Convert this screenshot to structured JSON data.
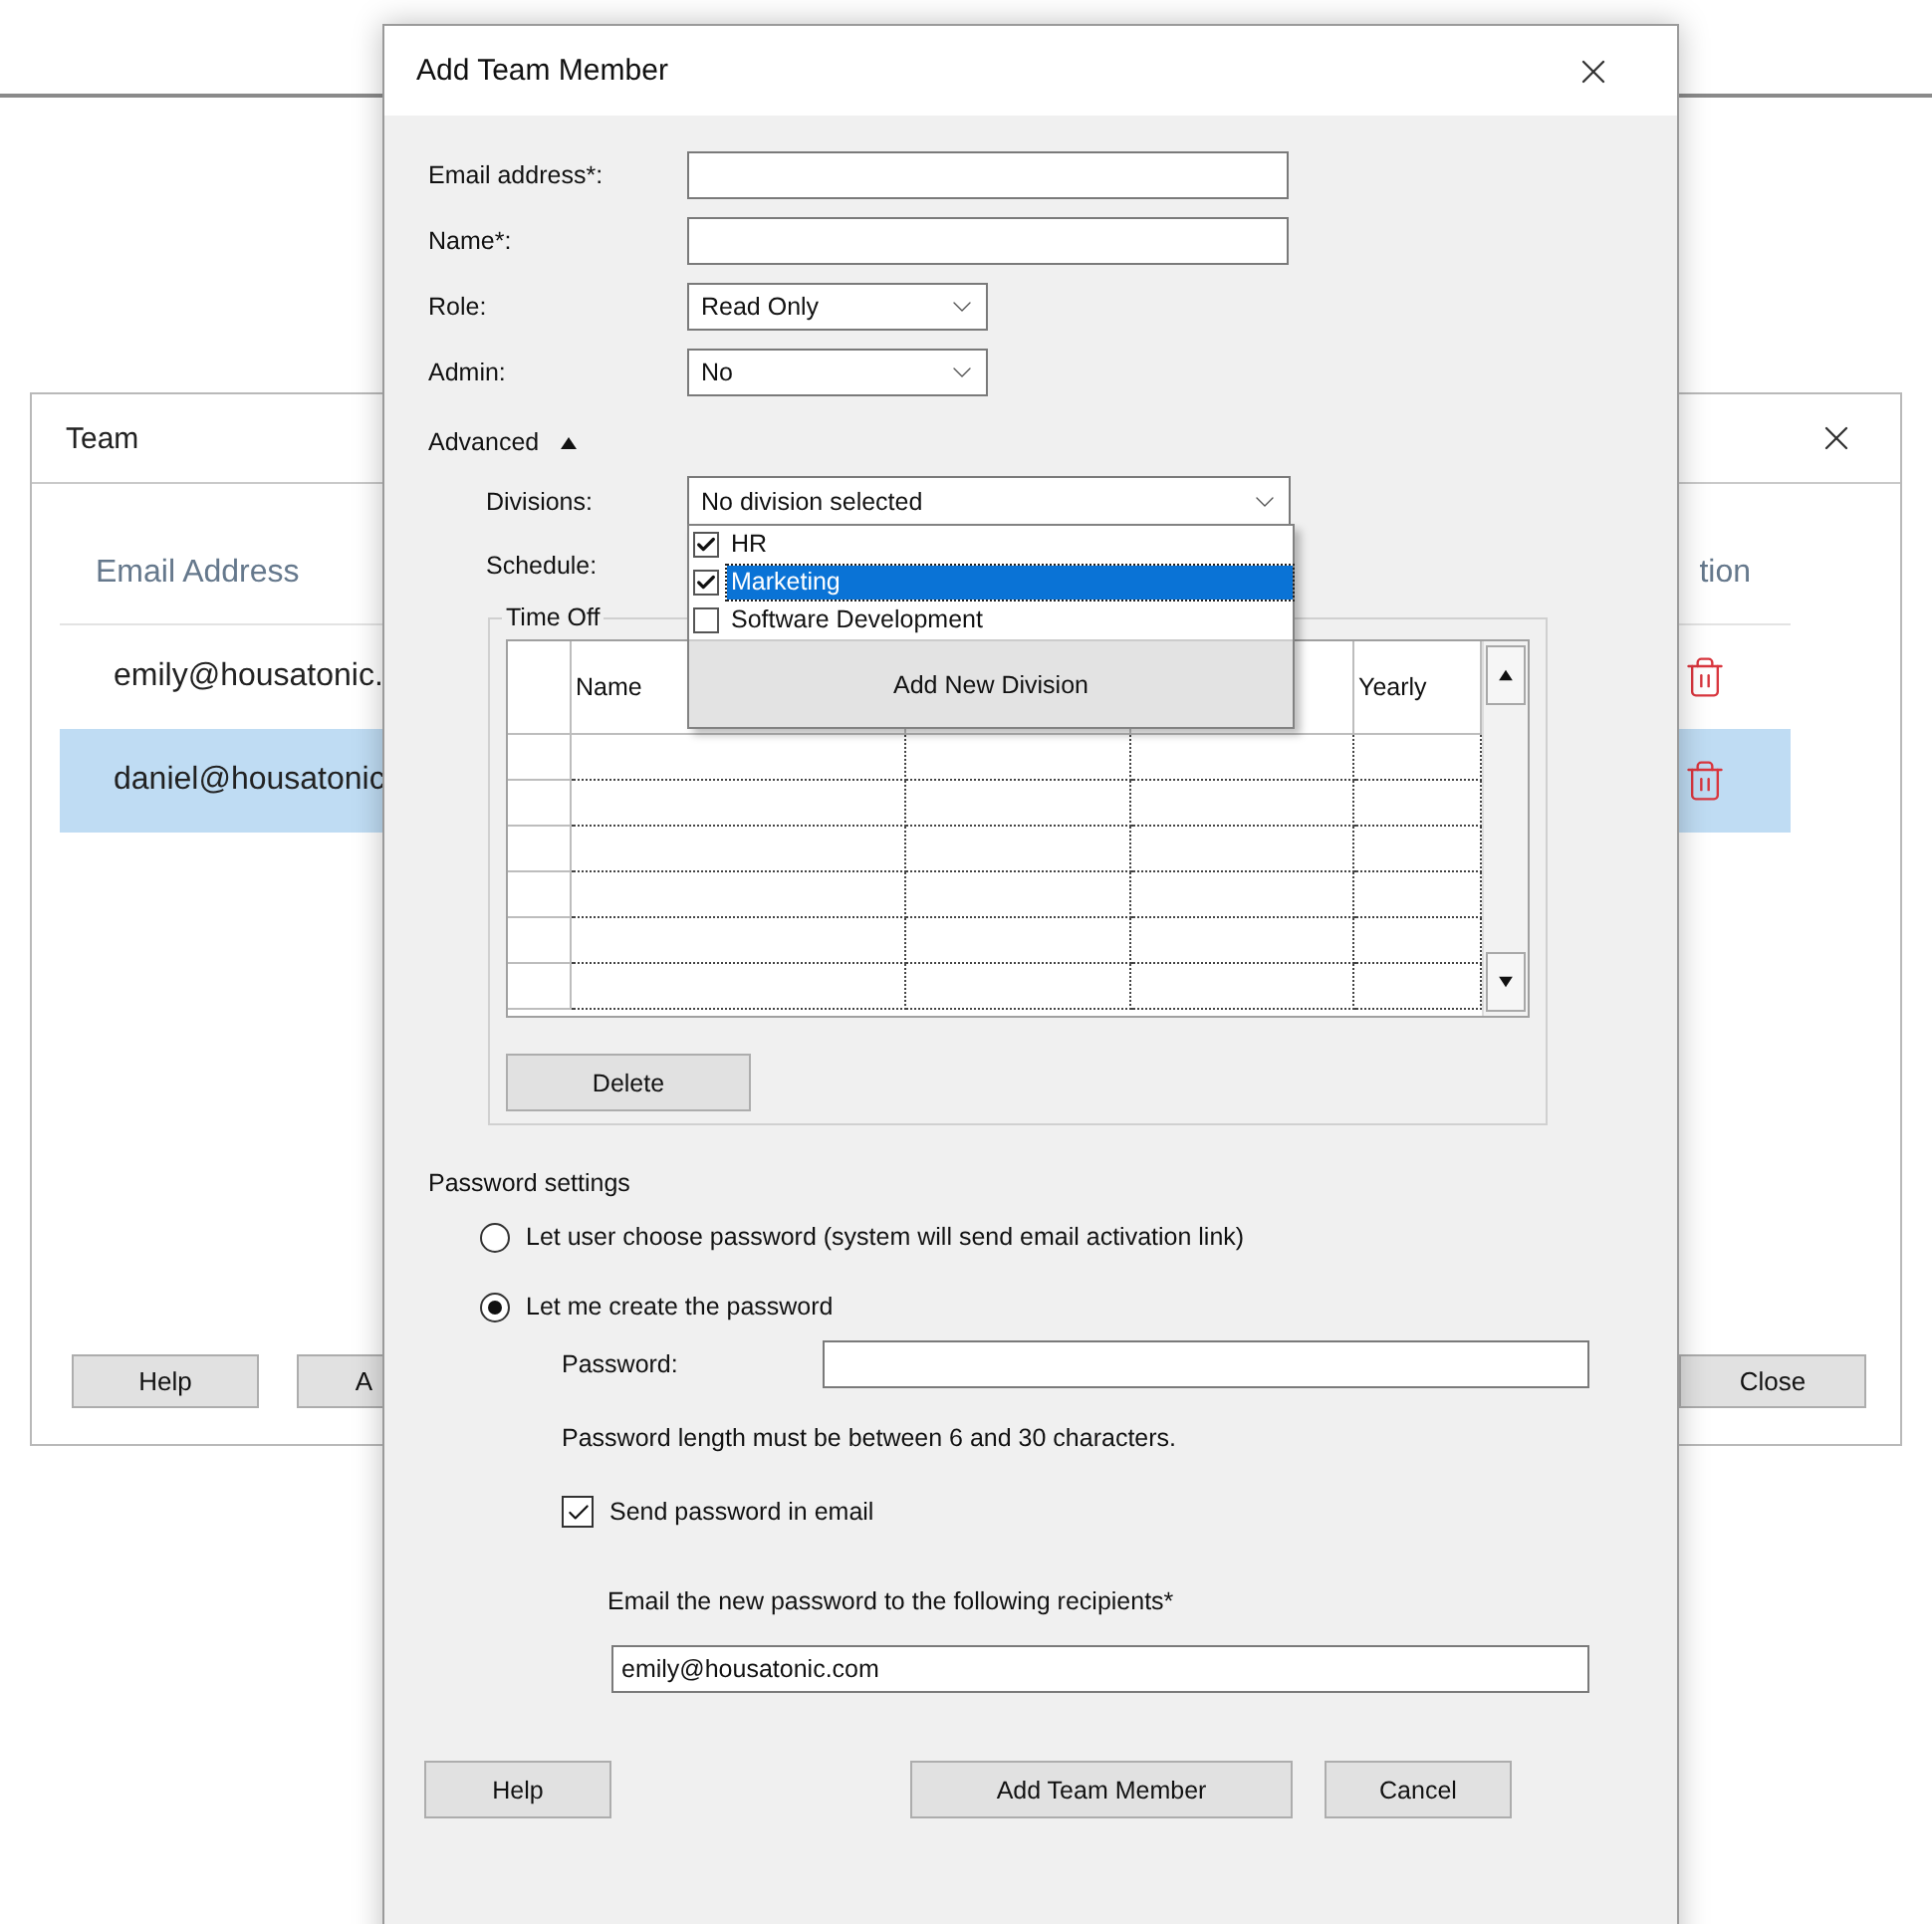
{
  "background_window": {
    "title": "Team",
    "columns": [
      "Email Address",
      "tion"
    ],
    "rows": [
      {
        "email": "emily@housatonic.",
        "selected": false
      },
      {
        "email": "daniel@housatonic",
        "selected": true
      }
    ],
    "buttons": [
      "Help",
      "A",
      "Close"
    ]
  },
  "dialog": {
    "title": "Add Team Member",
    "fields": [
      {
        "label": "Email address*:",
        "kind": "text"
      },
      {
        "label": "Name*:",
        "kind": "text"
      },
      {
        "label": "Role:",
        "kind": "select",
        "value": "Read Only"
      },
      {
        "label": "Admin:",
        "kind": "select",
        "value": "No"
      }
    ],
    "advanced": {
      "label": "Advanced",
      "expanded": true
    },
    "divisions": {
      "label": "Divisions:",
      "value": "No division selected",
      "expanded": true,
      "add_button": "Add New Division",
      "options": [
        {
          "label": "HR",
          "checked": true,
          "selected": false
        },
        {
          "label": "Marketing",
          "checked": true,
          "selected": true
        },
        {
          "label": "Software Development",
          "checked": false,
          "selected": false
        }
      ]
    },
    "schedule": {
      "label": "Schedule:"
    },
    "time_off": {
      "title": "Time Off",
      "columns": [
        "Name",
        null,
        null,
        "Yearly"
      ],
      "delete_button": "Delete"
    },
    "password_settings": {
      "title": "Password settings",
      "options": [
        {
          "label": "Let user choose password (system will send email activation link)",
          "selected": false
        },
        {
          "label": "Let me create the password",
          "selected": true
        }
      ],
      "password_label": "Password:",
      "hint": "Password length must be between 6 and 30 characters.",
      "send_email": {
        "label": "Send password in email",
        "checked": true
      },
      "recipients_label": "Email the new password to the following recipients*",
      "recipients_value": "emily@housatonic.com"
    },
    "buttons": [
      "Help",
      "Add Team Member",
      "Cancel"
    ]
  }
}
